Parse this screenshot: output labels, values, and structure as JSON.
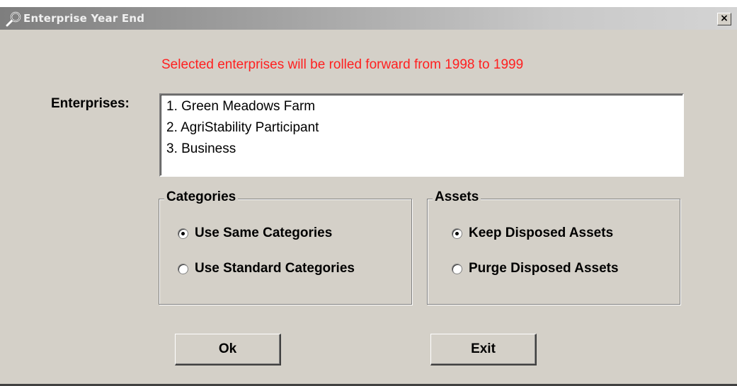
{
  "window": {
    "title": "Enterprise Year End",
    "close_label": "×"
  },
  "notice": "Selected enterprises will be rolled forward from 1998 to 1999",
  "enterprises": {
    "label": "Enterprises:",
    "items": [
      "1. Green Meadows Farm",
      "2. AgriStability Participant",
      "3. Business"
    ]
  },
  "categories": {
    "legend": "Categories",
    "options": [
      {
        "label": "Use Same Categories",
        "selected": true
      },
      {
        "label": "Use Standard Categories",
        "selected": false
      }
    ]
  },
  "assets": {
    "legend": "Assets",
    "options": [
      {
        "label": "Keep Disposed Assets",
        "selected": true
      },
      {
        "label": "Purge Disposed Assets",
        "selected": false
      }
    ]
  },
  "buttons": {
    "ok_label": "Ok",
    "exit_label": "Exit"
  },
  "colors": {
    "notice": "#ff2020",
    "window_bg": "#d4d0c8"
  },
  "icons": {
    "title": "magnifier-icon"
  }
}
